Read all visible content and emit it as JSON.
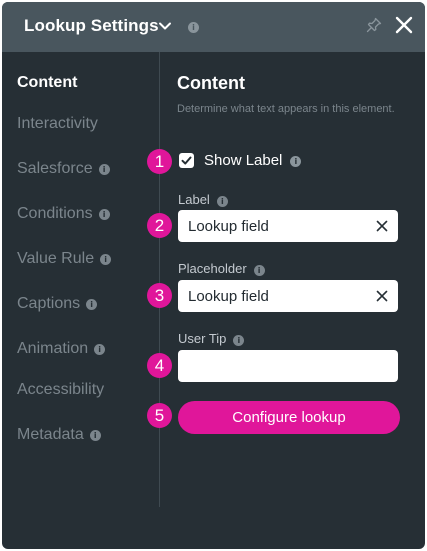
{
  "header": {
    "title": "Lookup Settings",
    "info": "i"
  },
  "sidebar": {
    "items": [
      {
        "label": "Content",
        "info": ""
      },
      {
        "label": "Interactivity",
        "info": ""
      },
      {
        "label": "Salesforce",
        "info": "i"
      },
      {
        "label": "Conditions",
        "info": "i"
      },
      {
        "label": "Value Rule",
        "info": "i"
      },
      {
        "label": "Captions",
        "info": "i"
      },
      {
        "label": "Animation",
        "info": "i"
      },
      {
        "label": "Accessibility",
        "info": ""
      },
      {
        "label": "Metadata",
        "info": "i"
      }
    ]
  },
  "main": {
    "title": "Content",
    "description": "Determine what text appears in this element.",
    "show_label": {
      "label": "Show Label",
      "checked": true,
      "info": "i"
    },
    "label_field": {
      "label": "Label",
      "value": "Lookup field",
      "info": "i"
    },
    "placeholder_field": {
      "label": "Placeholder",
      "value": "Lookup field",
      "info": "i"
    },
    "user_tip_field": {
      "label": "User Tip",
      "value": "",
      "info": "i"
    },
    "configure_button": "Configure lookup"
  },
  "steps": [
    "1",
    "2",
    "3",
    "4",
    "5"
  ],
  "colors": {
    "panel_bg": "#262f35",
    "header_bg": "#49565e",
    "accent": "#e0169a"
  }
}
